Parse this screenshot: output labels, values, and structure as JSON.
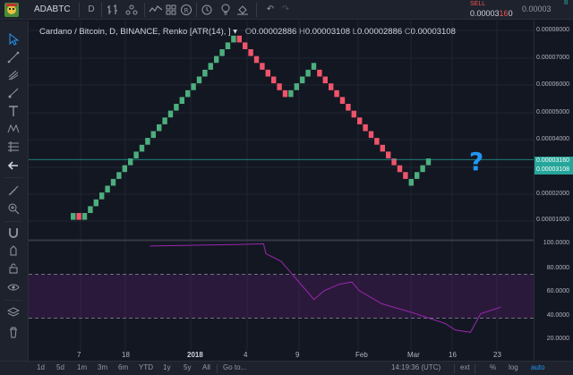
{
  "toolbar": {
    "symbol": "ADABTC",
    "interval": "D",
    "sell_label": "SELL",
    "sell_price_main": "0.00003",
    "sell_price_hl": "16",
    "sell_price_tail": "0",
    "buy_price": "0.00003",
    "buy_label": "B"
  },
  "legend": {
    "title": "Cardano / Bitcoin, D, BINANCE, Renko [ATR(14), ] ▾",
    "o_label": "O",
    "o_value": "0.00002886",
    "h_label": "H",
    "h_value": "0.00003108",
    "l_label": "L",
    "l_value": "0.00002886",
    "c_label": "C",
    "c_value": "0.00003108"
  },
  "price_axis": {
    "labels": [
      "0.00008000",
      "0.00007000",
      "0.00006000",
      "0.00005000",
      "0.00004000",
      "0.00003000",
      "0.00002000",
      "0.00001000"
    ],
    "last_price_top": "0.00003160",
    "last_price_bottom": "0.00003108",
    "indicator_labels": [
      "100.0000",
      "80.0000",
      "60.0000",
      "40.0000",
      "20.0000"
    ]
  },
  "time_axis": [
    "7",
    "18",
    "2018",
    "4",
    "9",
    "Feb",
    "Mar",
    "16",
    "23"
  ],
  "annotation": "?",
  "bottom": {
    "ranges": [
      "1d",
      "5d",
      "1m",
      "3m",
      "6m",
      "YTD",
      "1y",
      "5y",
      "All"
    ],
    "goto": "Go to...",
    "time": "14:19:36 (UTC)",
    "ext": "ext",
    "pct": "%",
    "log": "log",
    "auto": "auto"
  },
  "colors": {
    "up": "#26a69a",
    "up_brick": "#4caf7d",
    "down": "#ef5350",
    "down_brick": "#f0546a",
    "rsi": "#9c27b0",
    "accent": "#2196f3"
  },
  "chart_data": [
    {
      "type": "renko",
      "title": "Cardano / Bitcoin, D, BINANCE, Renko [ATR(14), ]",
      "brick_size": 2.5e-06,
      "bricks": [
        {
          "dir": "up",
          "count": 1,
          "from": 9.5e-06
        },
        {
          "dir": "down",
          "count": 1,
          "from": 1.2e-05
        },
        {
          "dir": "up",
          "count": 27,
          "from": 9.5e-06
        },
        {
          "dir": "down",
          "count": 9,
          "from": 7.7e-05
        },
        {
          "dir": "up",
          "count": 5,
          "from": 5.45e-05
        },
        {
          "dir": "down",
          "count": 16,
          "from": 6.45e-05
        },
        {
          "dir": "up",
          "count": 4,
          "from": 2.2e-05
        }
      ],
      "ylim": [
        2.5e-06,
        8.25e-05
      ],
      "last_price": 3.16e-05
    },
    {
      "type": "line",
      "name": "RSI",
      "ylim": [
        0,
        100
      ],
      "levels": [
        70,
        30
      ],
      "points": [
        [
          0.24,
          96
        ],
        [
          0.42,
          97.5
        ],
        [
          0.465,
          98
        ],
        [
          0.47,
          89
        ],
        [
          0.5,
          82
        ],
        [
          0.565,
          47
        ],
        [
          0.585,
          55
        ],
        [
          0.615,
          61
        ],
        [
          0.64,
          63
        ],
        [
          0.655,
          55
        ],
        [
          0.7,
          43
        ],
        [
          0.76,
          35
        ],
        [
          0.825,
          25
        ],
        [
          0.845,
          19
        ],
        [
          0.875,
          17
        ],
        [
          0.895,
          34
        ],
        [
          0.935,
          40
        ]
      ]
    }
  ]
}
